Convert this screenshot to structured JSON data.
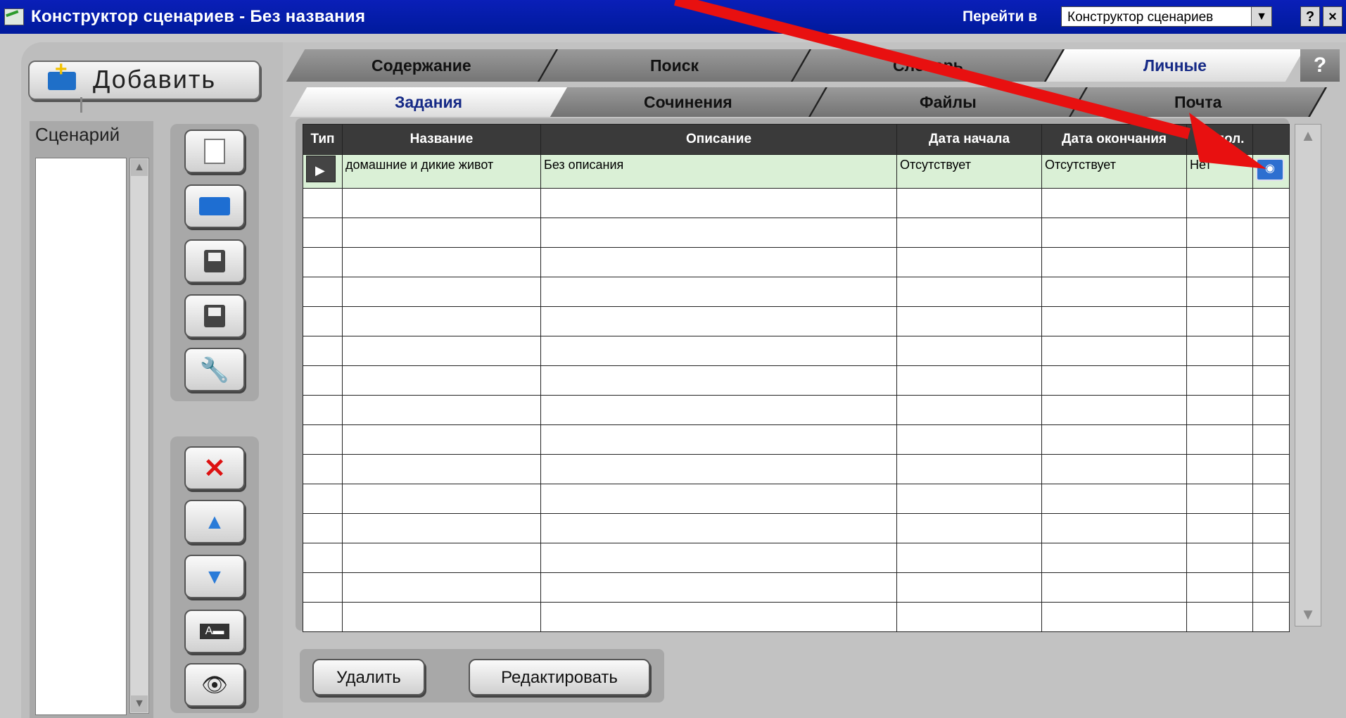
{
  "window": {
    "title": "Конструктор сценариев - Без названия",
    "goto_label": "Перейти в",
    "goto_selected": "Конструктор сценариев",
    "help_btn": "?",
    "close_btn": "×"
  },
  "left": {
    "add_label": "Добавить",
    "scenario_label": "Сценарий",
    "tools": [
      "new-document-icon",
      "open-folder-icon",
      "save-disk-icon",
      "save-as-disk-icon",
      "settings-wrench-icon",
      "delete-x-icon",
      "move-up-icon",
      "move-down-icon",
      "text-label-icon",
      "view-eye-icon"
    ]
  },
  "tabs": {
    "main": [
      "Содержание",
      "Поиск",
      "Словарь",
      "Личные"
    ],
    "active_main": "Личные",
    "help": "?",
    "sub": [
      "Задания",
      "Сочинения",
      "Файлы",
      "Почта"
    ],
    "active_sub": "Задания"
  },
  "table": {
    "columns": [
      "Тип",
      "Название",
      "Описание",
      "Дата начала",
      "Дата окончания",
      "Выпол.",
      ""
    ],
    "rows": [
      {
        "name": "домашние и дикие живот",
        "description": "Без описания",
        "start": "Отсутствует",
        "end": "Отсутствует",
        "done": "Нет"
      }
    ]
  },
  "actions": {
    "delete": "Удалить",
    "edit": "Редактировать"
  },
  "colors": {
    "title_bar": "#0a1fb8",
    "selected_row": "#daf0d6",
    "annotation": "#e81010"
  }
}
